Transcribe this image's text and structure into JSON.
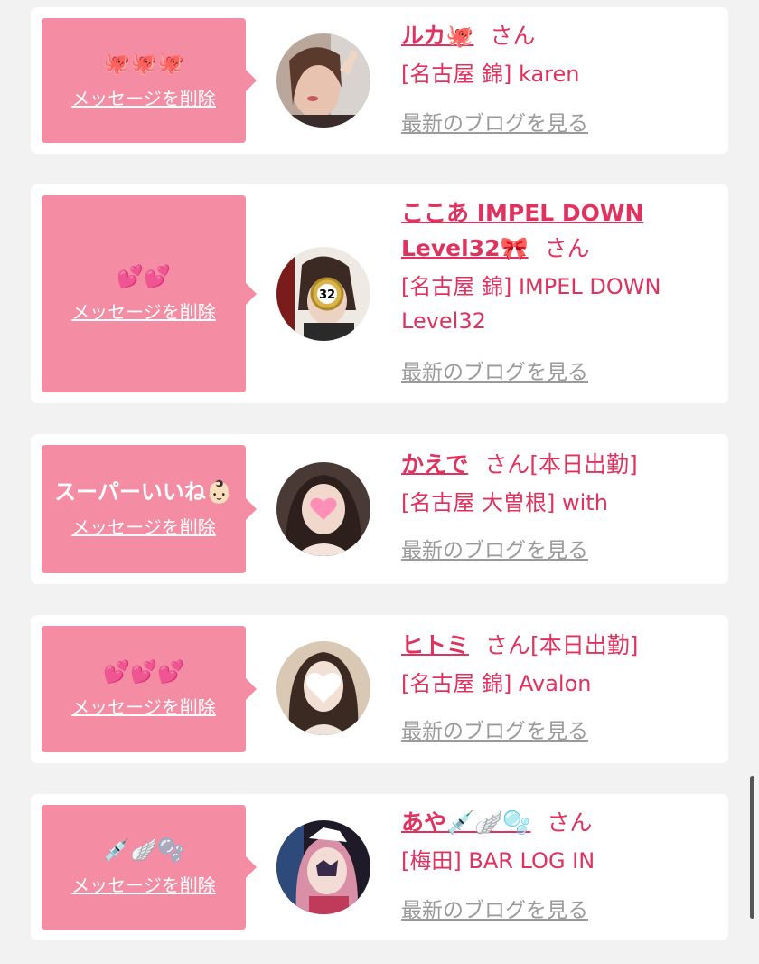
{
  "cards": [
    {
      "message": "🐙🐙🐙",
      "delete_label": "メッセージを削除",
      "name": "ルカ🐙",
      "honorific": "さん",
      "status": "",
      "shop": "[名古屋 錦] karen",
      "blog_link": "最新のブログを見る"
    },
    {
      "message": "💕💕",
      "delete_label": "メッセージを削除",
      "name": "ここあ IMPEL DOWN Level32🎀",
      "honorific": "さん",
      "status": "",
      "shop": "[名古屋 錦] IMPEL DOWN Level32",
      "blog_link": "最新のブログを見る",
      "avatar_badge": "32"
    },
    {
      "message": "スーパーいいね👶🏻",
      "delete_label": "メッセージを削除",
      "name": "かえで",
      "honorific": "さん",
      "status": "[本日出勤]",
      "shop": "[名古屋 大曽根] with",
      "blog_link": "最新のブログを見る"
    },
    {
      "message": "💕💕💕",
      "delete_label": "メッセージを削除",
      "name": "ヒトミ",
      "honorific": "さん",
      "status": "[本日出勤]",
      "shop": "[名古屋 錦] Avalon",
      "blog_link": "最新のブログを見る"
    },
    {
      "message": "💉🪽🫧",
      "delete_label": "メッセージを削除",
      "name": "あや💉🪽🫧",
      "honorific": "さん",
      "status": "",
      "shop": "[梅田] BAR LOG IN",
      "blog_link": "最新のブログを見る"
    }
  ],
  "colors": {
    "accent": "#e0325f",
    "bubble": "#f48ca3",
    "link_gray": "#9a9a9a",
    "background": "#f2f2f2"
  }
}
